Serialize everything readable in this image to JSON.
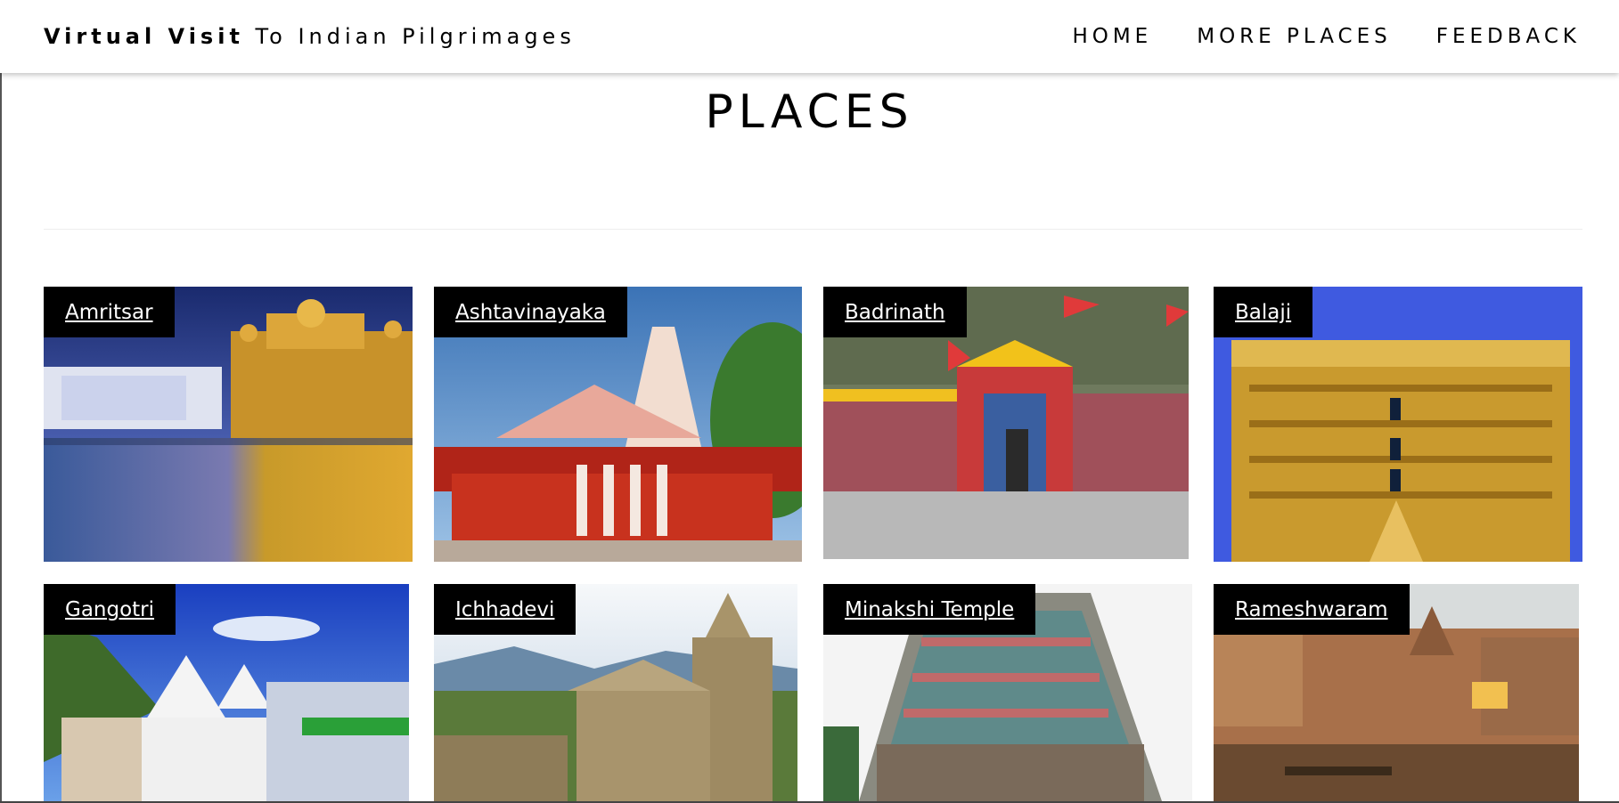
{
  "navbar": {
    "brand_bold": "Virtual Visit",
    "brand_rest": " To Indian Pilgrimages",
    "links": [
      "HOME",
      "MORE PLACES",
      "FEEDBACK"
    ]
  },
  "page": {
    "title": "PLACES"
  },
  "places": [
    {
      "name": "Amritsar"
    },
    {
      "name": "Ashtavinayaka"
    },
    {
      "name": "Badrinath"
    },
    {
      "name": "Balaji"
    },
    {
      "name": "Gangotri"
    },
    {
      "name": "Ichhadevi"
    },
    {
      "name": "Minakshi Temple"
    },
    {
      "name": "Rameshwaram"
    }
  ],
  "colors": {
    "label_bg": "#000000",
    "label_text": "#ffffff",
    "nav_bg": "#ffffff"
  }
}
